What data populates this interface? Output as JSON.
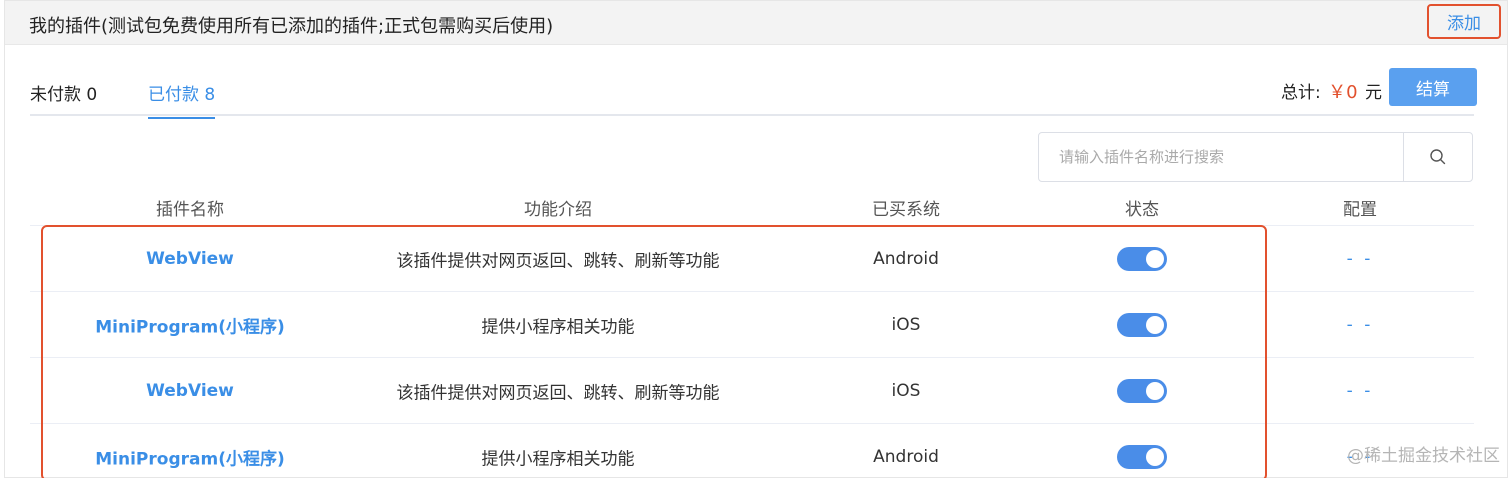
{
  "header": {
    "title": "我的插件(测试包免费使用所有已添加的插件;正式包需购买后使用)",
    "add_label": "添加"
  },
  "tabs": [
    {
      "label": "未付款 0"
    },
    {
      "label": "已付款 8"
    }
  ],
  "summary": {
    "total_label": "总计:",
    "amount": "￥0",
    "unit": "元",
    "checkout_label": "结算"
  },
  "search": {
    "placeholder": "请输入插件名称进行搜索"
  },
  "table": {
    "columns": [
      "插件名称",
      "功能介绍",
      "已买系统",
      "状态",
      "配置"
    ],
    "rows": [
      {
        "name": "WebView",
        "description": "该插件提供对网页返回、跳转、刷新等功能",
        "system": "Android",
        "status": "on",
        "config": "- -"
      },
      {
        "name": "MiniProgram(小程序)",
        "description": "提供小程序相关功能",
        "system": "iOS",
        "status": "on",
        "config": "- -"
      },
      {
        "name": "WebView",
        "description": "该插件提供对网页返回、跳转、刷新等功能",
        "system": "iOS",
        "status": "on",
        "config": "- -"
      },
      {
        "name": "MiniProgram(小程序)",
        "description": "提供小程序相关功能",
        "system": "Android",
        "status": "on",
        "config": "- -"
      }
    ]
  },
  "watermark": "@稀土掘金技术社区",
  "colors": {
    "accent": "#3a8ee6",
    "toggle_on": "#4a8de8",
    "highlight": "#e2512e",
    "price": "#e2512e",
    "checkout_bg": "#5aa0ef"
  }
}
